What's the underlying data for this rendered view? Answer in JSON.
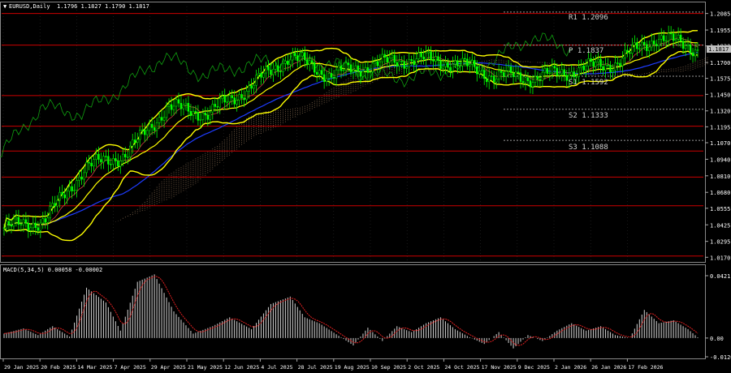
{
  "window": {
    "symbol_header": "EURUSD,Daily",
    "ohlc": "1.1796 1.1827 1.1790 1.1817",
    "macd_header": "MACD(5,34,5) 0.00058 -0.00002"
  },
  "price_axis": {
    "ticks": [
      "1.2085",
      "1.1955",
      "1.1830",
      "1.1700",
      "1.1575",
      "1.1450",
      "1.1320",
      "1.1195",
      "1.1070",
      "1.0940",
      "1.0810",
      "1.0680",
      "1.0555",
      "1.0425",
      "1.0295",
      "1.0170"
    ],
    "current_price": "1.1817"
  },
  "macd_axis": {
    "ticks": [
      "0.04211",
      "0.00",
      "-0.01266"
    ]
  },
  "date_axis": {
    "labels": [
      "29 Jan 2025",
      "20 Feb 2025",
      "14 Mar 2025",
      "7 Apr 2025",
      "29 Apr 2025",
      "21 May 2025",
      "12 Jun 2025",
      "4 Jul 2025",
      "28 Jul 2025",
      "19 Aug 2025",
      "10 Sep 2025",
      "2 Oct 2025",
      "24 Oct 2025",
      "17 Nov 2025",
      "9 Dec 2025",
      "2 Jan 2026",
      "26 Jan 2026",
      "17 Feb 2026"
    ]
  },
  "pivot_labels": {
    "r1": "R1 1.2096",
    "p": "P 1.1837",
    "s1": "S1 1.1592",
    "s2": "S2 1.1333",
    "s3": "S3 1.1088"
  },
  "colors": {
    "background": "#000000",
    "grid": "#2a2a2a",
    "candle": "#00ff00",
    "bollinger": "#ffff00",
    "ma_blue": "#1e3cff",
    "level_red": "#cc0000",
    "pivot_dotted": "#9a9a9a",
    "ichimoku_cloud": "#c8a07a",
    "chikou": "#10a010",
    "macd_hist": "#c0c0c0",
    "macd_signal": "#e02020",
    "axis_text": "#ffffff"
  },
  "chart_data": [
    {
      "type": "line",
      "title": "EURUSD,Daily",
      "x": [
        "29 Jan 2025",
        "20 Feb 2025",
        "14 Mar 2025",
        "7 Apr 2025",
        "29 Apr 2025",
        "21 May 2025",
        "12 Jun 2025",
        "4 Jul 2025",
        "28 Jul 2025",
        "19 Aug 2025",
        "10 Sep 2025",
        "2 Oct 2025",
        "24 Oct 2025",
        "17 Nov 2025",
        "9 Dec 2025",
        "2 Jan 2026",
        "26 Jan 2026",
        "17 Feb 2026"
      ],
      "ylim": [
        1.014,
        1.214
      ],
      "series": [
        {
          "values": [
            1.04,
            1.046,
            1.088,
            1.098,
            1.135,
            1.13,
            1.15,
            1.175,
            1.16,
            1.168,
            1.173,
            1.17,
            1.16,
            1.158,
            1.164,
            1.17,
            1.19,
            1.181
          ]
        }
      ],
      "levels": [
        1.2085,
        1.1837,
        1.144,
        1.12,
        1.1005,
        1.08,
        1.0575,
        1.018
      ],
      "pivots": {
        "R1": 1.2096,
        "P": 1.1837,
        "S1": 1.1592,
        "S2": 1.1333,
        "S3": 1.1088
      },
      "legend": "none",
      "grid": true
    },
    {
      "type": "bar",
      "title": "MACD(5,34,5) 0.00058 -0.00002",
      "ylim": [
        -0.01266,
        0.04211
      ],
      "keyframes": [
        [
          0,
          0.003
        ],
        [
          8,
          0.0065
        ],
        [
          14,
          0.002
        ],
        [
          20,
          0.008
        ],
        [
          27,
          0.001
        ],
        [
          34,
          0.034
        ],
        [
          42,
          0.024
        ],
        [
          48,
          0.005
        ],
        [
          55,
          0.038
        ],
        [
          62,
          0.043
        ],
        [
          70,
          0.018
        ],
        [
          78,
          0.003
        ],
        [
          86,
          0.008
        ],
        [
          93,
          0.014
        ],
        [
          102,
          0.006
        ],
        [
          110,
          0.023
        ],
        [
          118,
          0.028
        ],
        [
          124,
          0.014
        ],
        [
          130,
          0.01
        ],
        [
          138,
          0.0015
        ],
        [
          144,
          -0.005
        ],
        [
          150,
          0.007
        ],
        [
          156,
          -0.002
        ],
        [
          162,
          0.008
        ],
        [
          168,
          0.004
        ],
        [
          174,
          0.01
        ],
        [
          180,
          0.014
        ],
        [
          186,
          0.006
        ],
        [
          192,
          0.0005
        ],
        [
          198,
          -0.004
        ],
        [
          204,
          0.004
        ],
        [
          210,
          -0.007
        ],
        [
          216,
          0.002
        ],
        [
          222,
          -0.002
        ],
        [
          228,
          0.005
        ],
        [
          234,
          0.01
        ],
        [
          240,
          0.005
        ],
        [
          246,
          0.008
        ],
        [
          252,
          0.002
        ],
        [
          258,
          0.0
        ],
        [
          264,
          0.019
        ],
        [
          270,
          0.01
        ],
        [
          276,
          0.012
        ],
        [
          282,
          0.006
        ],
        [
          286,
          0.0005
        ]
      ],
      "bar_count": 287,
      "legend": "none",
      "grid": false
    }
  ]
}
